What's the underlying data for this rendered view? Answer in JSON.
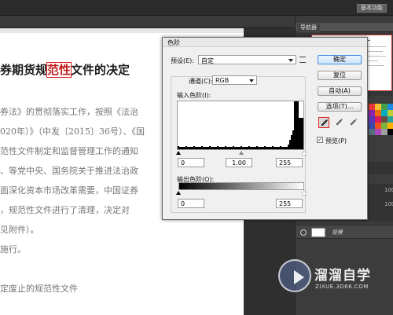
{
  "app": {
    "workspace_label": "基本功能"
  },
  "navigator": {
    "tab_label": "导航器"
  },
  "panels": {
    "layer_name": "背景",
    "side_numbers": [
      "100",
      "100"
    ]
  },
  "document": {
    "title_prefix": "券期货规",
    "title_highlight": "范性",
    "title_suffix": "文件的决定",
    "lines": [
      "券法》的贯彻落实工作，按照《法治",
      "020年）》（中发〔2015〕36号）、《国",
      "范性文件制定和监督管理工作的通知",
      "、等党中央、国务院关于推进法治政",
      "面深化资本市场改革需要，中国证券",
      "，规范性文件进行了清理，决定对",
      "见附件）。",
      "施行。",
      "定废止的规范性文件"
    ]
  },
  "levels_dialog": {
    "title": "色阶",
    "preset_label": "预设(E):",
    "preset_value": "自定",
    "channel_label": "通道(C):",
    "channel_value": "RGB",
    "input_levels_label": "输入色阶(I):",
    "input_black": "0",
    "input_gamma": "1.00",
    "input_white": "255",
    "output_levels_label": "输出色阶(O):",
    "output_black": "0",
    "output_white": "255",
    "buttons": {
      "ok": "确定",
      "reset": "复位",
      "auto": "自动(A)",
      "options": "选项(T)..."
    },
    "preview_label": "预览(P)",
    "preview_checked": true
  },
  "watermark": {
    "title": "溜溜自学",
    "url": "ZIXUE.3D66.COM"
  },
  "colors": {
    "highlight_red": "#e02020",
    "primary_button_border": "#3d8ee6"
  }
}
